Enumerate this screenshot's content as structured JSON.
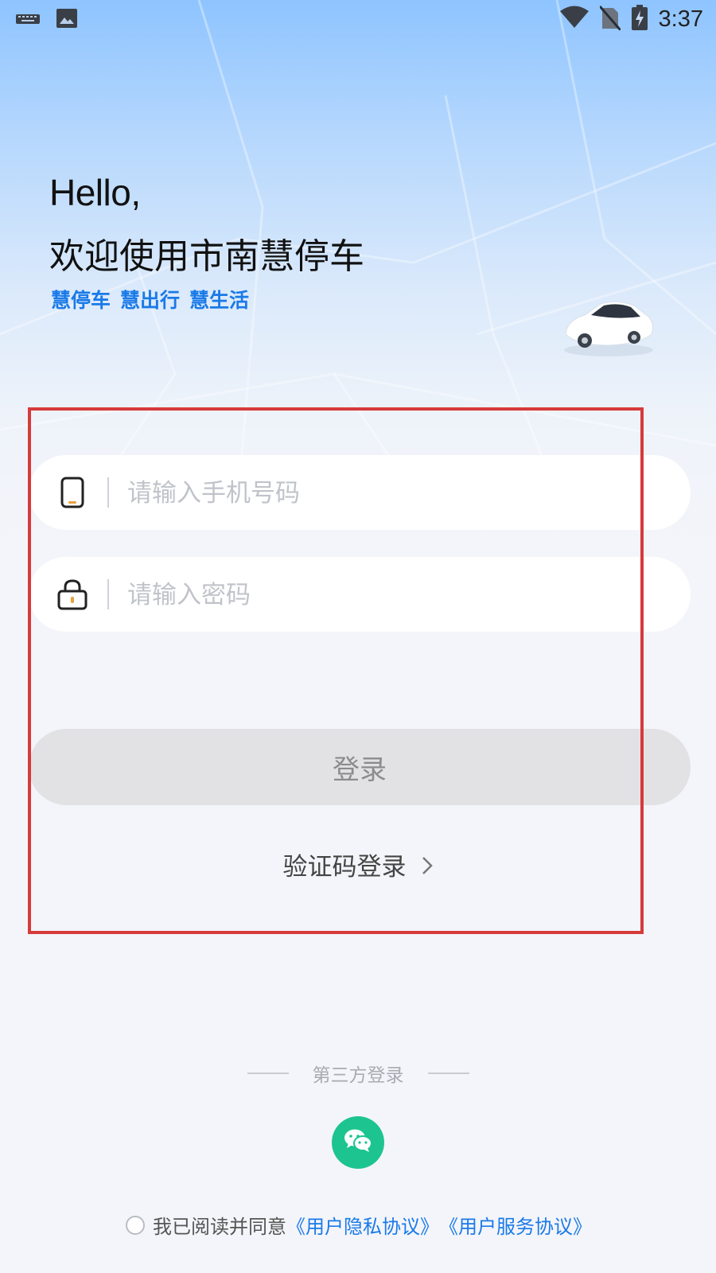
{
  "status_bar": {
    "time": "3:37",
    "left_icons": [
      "keyboard-icon",
      "image-icon"
    ],
    "right_icons": [
      "wifi-icon",
      "no-sim-icon",
      "battery-charging-icon"
    ]
  },
  "header": {
    "hello": "Hello,",
    "welcome": "欢迎使用市南慧停车",
    "tags": [
      "慧停车",
      "慧出行",
      "慧生活"
    ]
  },
  "form": {
    "phone": {
      "placeholder": "请输入手机号码",
      "value": "",
      "icon": "phone-icon"
    },
    "password": {
      "placeholder": "请输入密码",
      "value": "",
      "icon": "lock-icon"
    },
    "login_label": "登录",
    "code_login_label": "验证码登录"
  },
  "third_party": {
    "label": "第三方登录",
    "providers": [
      "wechat-icon"
    ]
  },
  "agreement": {
    "checked": false,
    "text": "我已阅读并同意",
    "privacy_link": "《用户隐私协议》",
    "service_link": "《用户服务协议》"
  },
  "colors": {
    "accent_blue": "#1a7ae8",
    "wechat_green": "#1dc48f",
    "highlight_red": "#d63a3a",
    "login_disabled_bg": "#e2e2e4"
  }
}
